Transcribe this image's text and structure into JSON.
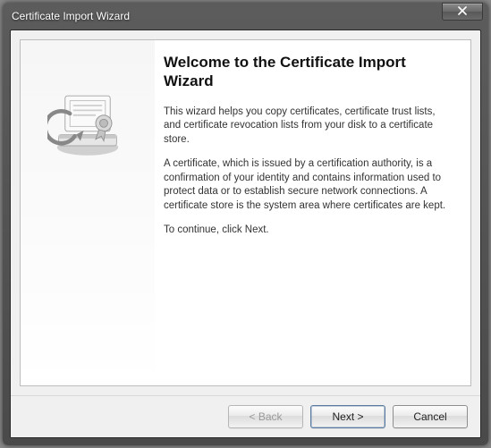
{
  "window": {
    "title": "Certificate Import Wizard"
  },
  "content": {
    "heading": "Welcome to the Certificate Import Wizard",
    "para1": "This wizard helps you copy certificates, certificate trust lists, and certificate revocation lists from your disk to a certificate store.",
    "para2": "A certificate, which is issued by a certification authority, is a confirmation of your identity and contains information used to protect data or to establish secure network connections. A certificate store is the system area where certificates are kept.",
    "para3": "To continue, click Next."
  },
  "buttons": {
    "back": "< Back",
    "next": "Next >",
    "cancel": "Cancel"
  }
}
